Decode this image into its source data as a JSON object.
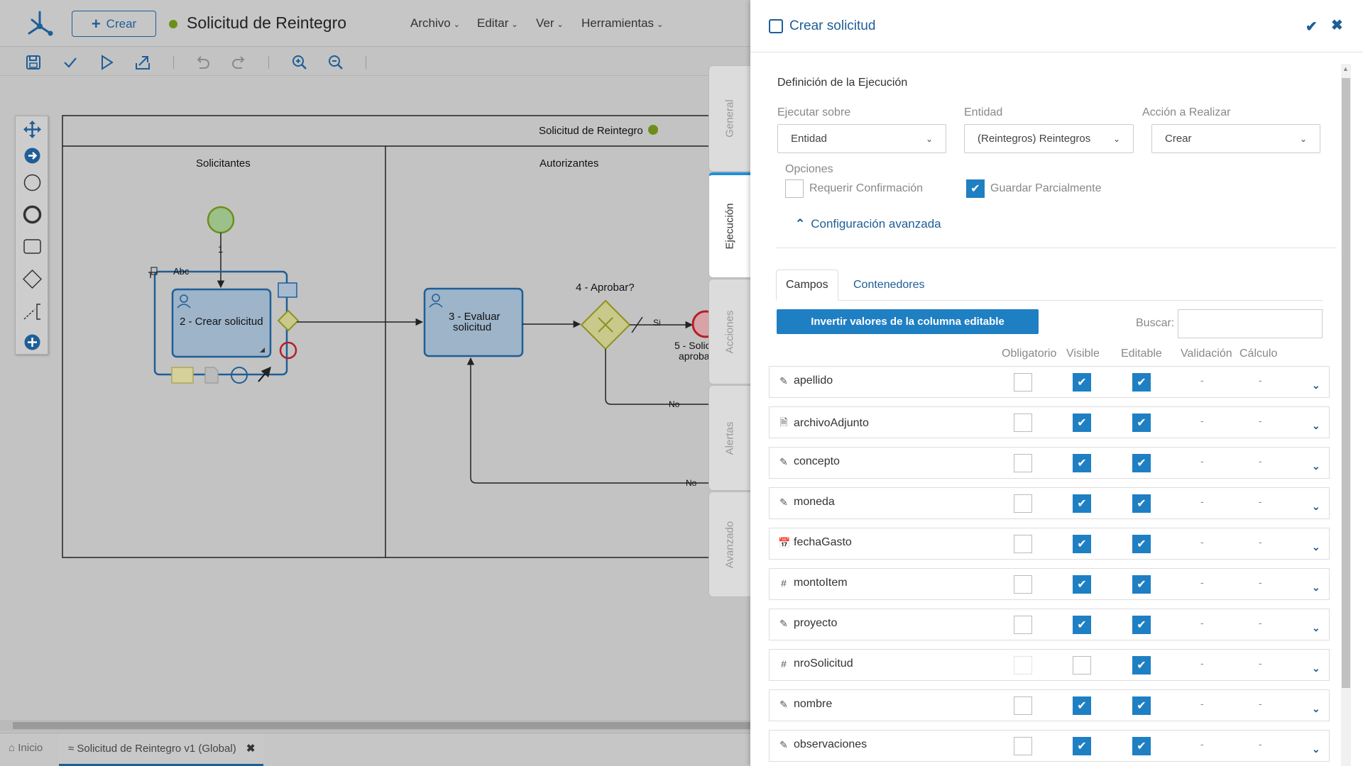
{
  "editor": {
    "crear_label": "Crear",
    "process_title": "Solicitud de Reintegro",
    "menus": [
      "Archivo",
      "Editar",
      "Ver",
      "Herramientas"
    ],
    "pool_title": "Solicitud de Reintegro",
    "lane1": "Solicitantes",
    "lane2": "Autorizantes",
    "start_label": "1",
    "task2": "2 - Crear solicitud",
    "task3_l1": "3 - Evaluar",
    "task3_l2": "solicitud",
    "gateway4": "4 - Aprobar?",
    "end5_l1": "5 - Solic",
    "end5_l2": "aproba",
    "flow_si": "Si",
    "flow_no1": "No",
    "flow_no2": "No",
    "abc": "Abc"
  },
  "side_tabs": [
    "General",
    "Ejecución",
    "Acciones",
    "Alertas",
    "Avanzado"
  ],
  "bottom_tabs": {
    "home": "Inicio",
    "active": "Solicitud de Reintegro v1 (Global)"
  },
  "panel": {
    "title": "Crear solicitud",
    "section_title": "Definición de la Ejecución",
    "ejecutar_label": "Ejecutar sobre",
    "ejecutar_value": "Entidad",
    "entidad_label": "Entidad",
    "entidad_value": "(Reintegros) Reintegros",
    "accion_label": "Acción a Realizar",
    "accion_value": "Crear",
    "opciones_label": "Opciones",
    "opt_requerir": "Requerir Confirmación",
    "opt_guardar": "Guardar Parcialmente",
    "adv_label": "Configuración avanzada",
    "tab_campos": "Campos",
    "tab_contenedores": "Contenedores",
    "invert_button": "Invertir valores de la columna editable",
    "search_label": "Buscar:",
    "columns": [
      "Obligatorio",
      "Visible",
      "Editable",
      "Validación",
      "Cálculo"
    ],
    "rows": [
      {
        "name": "apellido",
        "icon": "edit-icon",
        "obligatorio": false,
        "visible": true,
        "editable": true,
        "validacion": "-",
        "calculo": "-"
      },
      {
        "name": "archivoAdjunto",
        "icon": "file-icon",
        "obligatorio": false,
        "visible": true,
        "editable": true,
        "validacion": "-",
        "calculo": "-"
      },
      {
        "name": "concepto",
        "icon": "edit-icon",
        "obligatorio": false,
        "visible": true,
        "editable": true,
        "validacion": "-",
        "calculo": "-"
      },
      {
        "name": "moneda",
        "icon": "edit-icon",
        "obligatorio": false,
        "visible": true,
        "editable": true,
        "validacion": "-",
        "calculo": "-"
      },
      {
        "name": "fechaGasto",
        "icon": "calendar-icon",
        "obligatorio": false,
        "visible": true,
        "editable": true,
        "validacion": "-",
        "calculo": "-"
      },
      {
        "name": "montoItem",
        "icon": "hash-icon",
        "obligatorio": false,
        "visible": true,
        "editable": true,
        "validacion": "-",
        "calculo": "-"
      },
      {
        "name": "proyecto",
        "icon": "edit-icon",
        "obligatorio": false,
        "visible": true,
        "editable": true,
        "validacion": "-",
        "calculo": "-"
      },
      {
        "name": "nroSolicitud",
        "icon": "hash-icon",
        "obligatorio": false,
        "visible": false,
        "editable": true,
        "validacion": "-",
        "calculo": "-"
      },
      {
        "name": "nombre",
        "icon": "edit-icon",
        "obligatorio": false,
        "visible": true,
        "editable": true,
        "validacion": "-",
        "calculo": "-"
      },
      {
        "name": "observaciones",
        "icon": "edit-icon",
        "obligatorio": false,
        "visible": true,
        "editable": true,
        "validacion": "-",
        "calculo": "-"
      }
    ]
  },
  "colors": {
    "accent": "#1f5e96",
    "check": "#1f7fc3",
    "active_tab": "#1f8fd8"
  }
}
